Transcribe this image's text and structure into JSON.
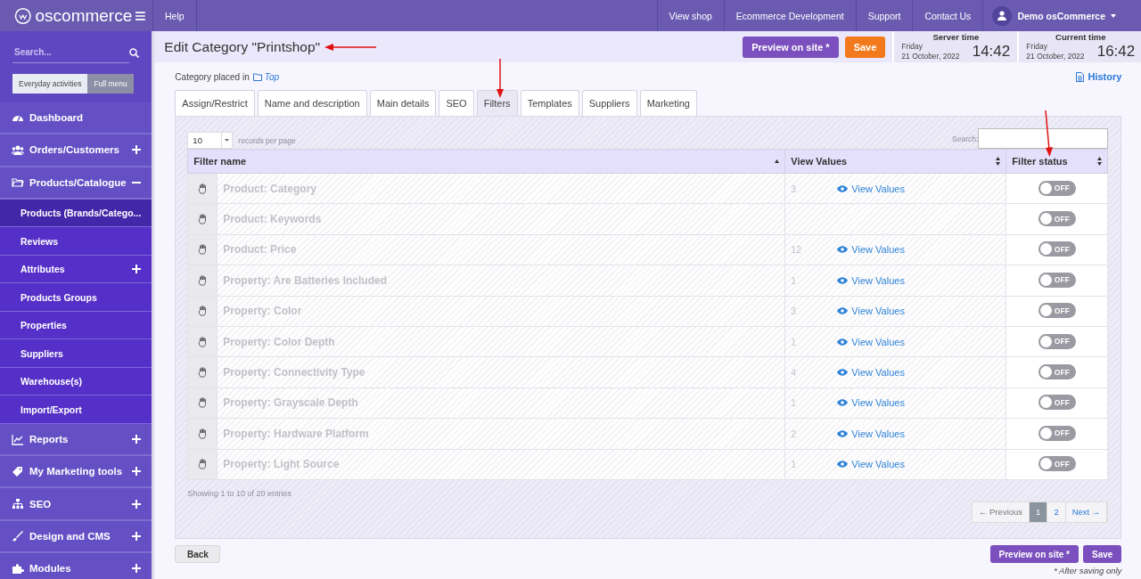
{
  "topbar": {
    "logo": "oscommerce",
    "help": "Help",
    "links": [
      "View shop",
      "Ecommerce Development",
      "Support",
      "Contact Us"
    ],
    "user": "Demo osCommerce"
  },
  "sidebar": {
    "search": {
      "placeholder": "Search..."
    },
    "modes": [
      {
        "label": "Everyday activities",
        "selected": true
      },
      {
        "label": "Full menu",
        "selected": false
      }
    ],
    "items": [
      {
        "label": "Dashboard"
      },
      {
        "label": "Orders/Customers",
        "expanded": false
      },
      {
        "label": "Products/Catalogue",
        "expanded": true,
        "children": [
          {
            "label": "Products (Brands/Catego...",
            "selected": true
          },
          {
            "label": "Reviews",
            "selected": false
          },
          {
            "label": "Attributes",
            "selected": false,
            "expanded": false
          },
          {
            "label": "Products Groups",
            "selected": false
          },
          {
            "label": "Properties",
            "selected": false
          },
          {
            "label": "Suppliers",
            "selected": false
          },
          {
            "label": "Warehouse(s)",
            "selected": false
          },
          {
            "label": "Import/Export",
            "selected": false
          }
        ]
      },
      {
        "label": "Reports",
        "expanded": false
      },
      {
        "label": "My Marketing tools",
        "expanded": false
      },
      {
        "label": "SEO",
        "expanded": false
      },
      {
        "label": "Design and CMS",
        "expanded": false
      },
      {
        "label": "Modules",
        "expanded": false
      }
    ]
  },
  "header": {
    "title": "Edit Category \"Printshop\"",
    "preview": "Preview on site *",
    "save": "Save",
    "clocks": [
      {
        "label": "Server time",
        "day": "Friday",
        "date": "21 October, 2022",
        "time": "14:42"
      },
      {
        "label": "Current time",
        "day": "Friday",
        "date": "21 October, 2022",
        "time": "16:42"
      }
    ]
  },
  "placed": {
    "label": "Category placed in",
    "link": "Top"
  },
  "history": "History",
  "tabs": [
    {
      "label": "Assign/Restrict",
      "selected": false
    },
    {
      "label": "Name and description",
      "selected": false
    },
    {
      "label": "Main details",
      "selected": false
    },
    {
      "label": "SEO",
      "selected": false
    },
    {
      "label": "Filters",
      "selected": true
    },
    {
      "label": "Templates",
      "selected": false
    },
    {
      "label": "Suppliers",
      "selected": false
    },
    {
      "label": "Marketing",
      "selected": false
    }
  ],
  "table": {
    "per_page": "10",
    "per_page_label": "records per page",
    "search_label": "Search:",
    "columns": [
      "Filter name",
      "View Values",
      "Filter status"
    ],
    "rows": [
      {
        "name": "Product: Category",
        "count": "3",
        "link": "View Values",
        "status": "OFF",
        "on": false
      },
      {
        "name": "Product: Keywords",
        "status": "OFF",
        "on": false
      },
      {
        "name": "Product: Price",
        "count": "12",
        "link": "View Values",
        "status": "OFF",
        "on": false
      },
      {
        "name": "Property: Are Batteries Included",
        "count": "1",
        "link": "View Values",
        "status": "OFF",
        "on": false
      },
      {
        "name": "Property: Color",
        "count": "3",
        "link": "View Values",
        "status": "OFF",
        "on": false
      },
      {
        "name": "Property: Color Depth",
        "count": "1",
        "link": "View Values",
        "status": "OFF",
        "on": false
      },
      {
        "name": "Property: Connectivity Type",
        "count": "4",
        "link": "View Values",
        "status": "OFF",
        "on": false
      },
      {
        "name": "Property: Grayscale Depth",
        "count": "1",
        "link": "View Values",
        "status": "OFF",
        "on": false
      },
      {
        "name": "Property: Hardware Platform",
        "count": "2",
        "link": "View Values",
        "status": "OFF",
        "on": false
      },
      {
        "name": "Property: Light Source",
        "count": "1",
        "link": "View Values",
        "status": "OFF",
        "on": false
      }
    ],
    "info": "Showing 1 to 10 of 20 entries",
    "pagination": [
      {
        "label": "← Previous",
        "disabled": true,
        "selected": false
      },
      {
        "label": "1",
        "disabled": false,
        "selected": true
      },
      {
        "label": "2",
        "disabled": false,
        "selected": false
      },
      {
        "label": "Next →",
        "disabled": false,
        "selected": false
      }
    ]
  },
  "footer": {
    "back": "Back",
    "preview": "Preview on site *",
    "save": "Save",
    "note": "* After saving only"
  }
}
